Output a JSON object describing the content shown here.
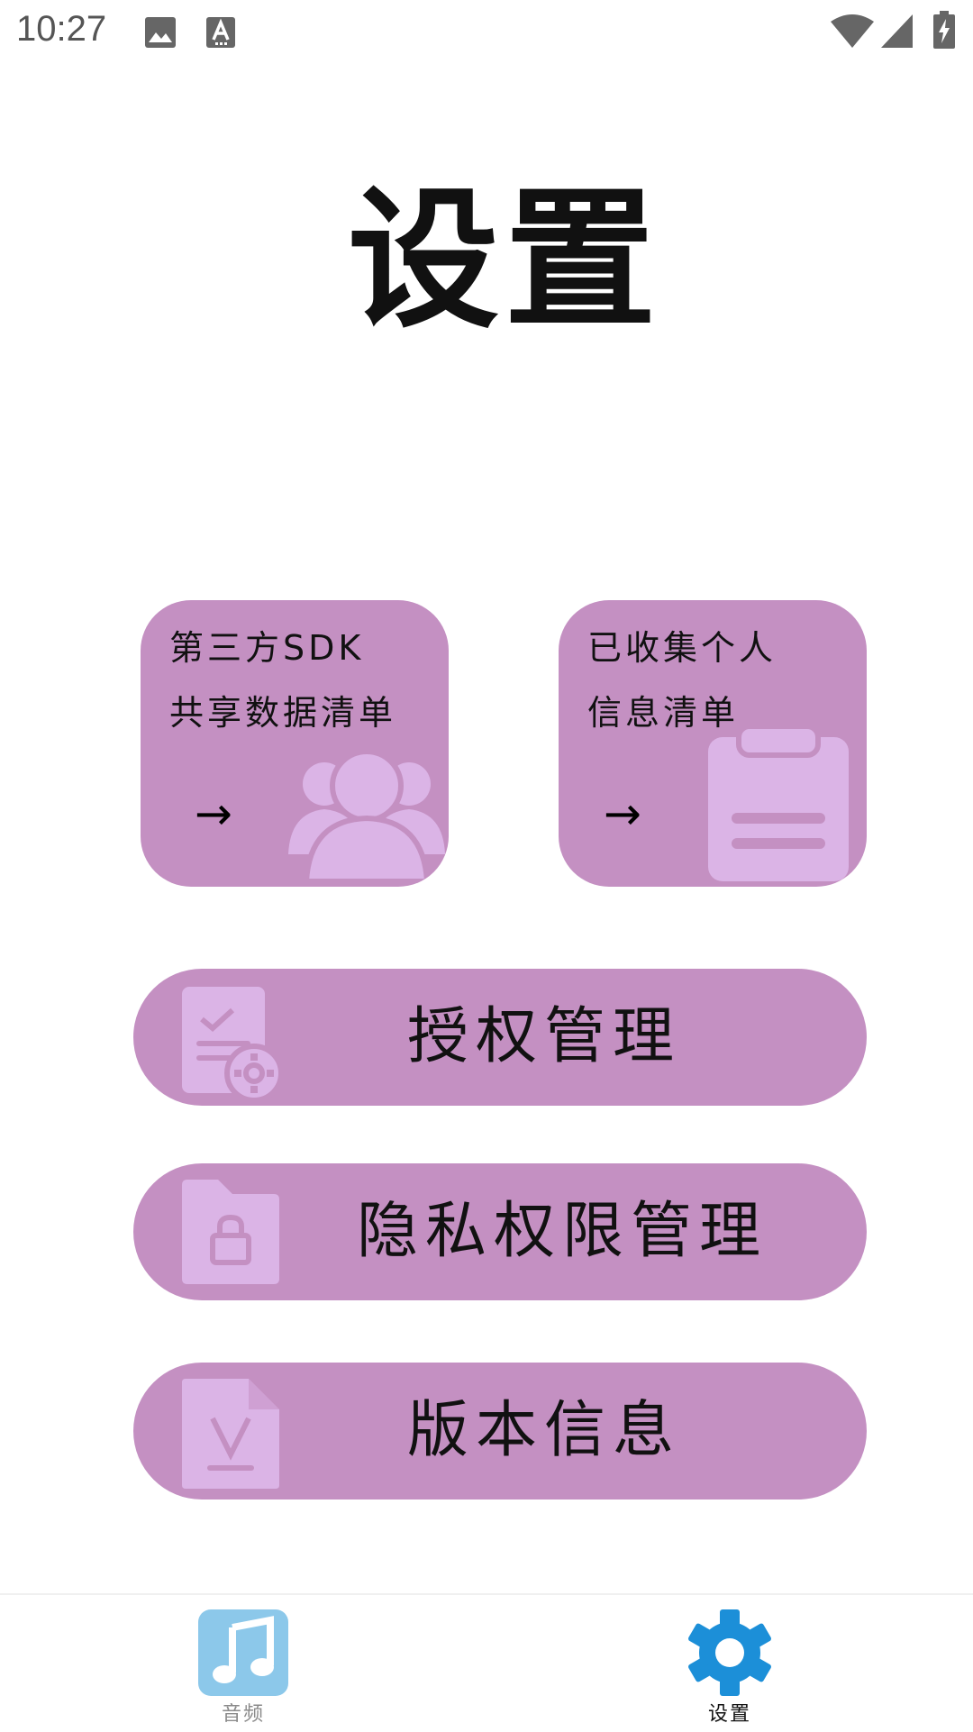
{
  "status_bar": {
    "time": "10:27",
    "left_icons": [
      "image-icon",
      "text-input-icon"
    ],
    "right_icons": [
      "wifi-icon",
      "cell-signal-icon",
      "battery-charging-icon"
    ]
  },
  "page": {
    "title": "设置"
  },
  "cards": {
    "sdk": {
      "line1": "第三方SDK",
      "line2": "共享数据清单",
      "arrow": "→",
      "icon": "people-icon"
    },
    "personal": {
      "line1": "已收集个人",
      "line2": "信息清单",
      "arrow": "→",
      "icon": "clipboard-icon"
    }
  },
  "menu": {
    "auth": {
      "label": "授权管理",
      "icon": "document-settings-icon"
    },
    "privacy": {
      "label": "隐私权限管理",
      "icon": "lock-folder-icon"
    },
    "version": {
      "label": "版本信息",
      "icon": "version-file-icon"
    }
  },
  "bottom_nav": {
    "audio": {
      "label": "音频",
      "icon": "music-note-icon",
      "active": false
    },
    "settings": {
      "label": "设置",
      "icon": "gear-icon",
      "active": true
    }
  },
  "colors": {
    "card_bg": "#c490c2",
    "card_icon": "#dbb4e6",
    "nav_audio_icon": "#8cc8ea",
    "nav_settings_icon": "#1c8fd8"
  }
}
